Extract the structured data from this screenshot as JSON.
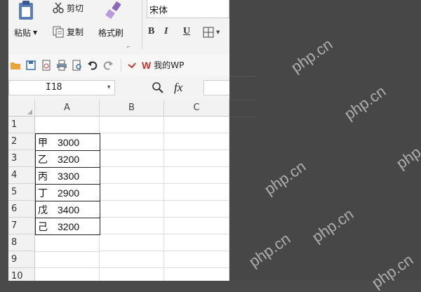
{
  "ribbon": {
    "paste_label": "粘贴",
    "cut_label": "剪切",
    "copy_label": "复制",
    "format_painter_label": "格式刷",
    "font_name": "宋体",
    "bold": "B",
    "italic": "I",
    "underline": "U"
  },
  "quick_access": {
    "wps_label": "我的WP"
  },
  "formula_bar": {
    "name_box": "I18",
    "fx": "fx"
  },
  "grid": {
    "columns": [
      "A",
      "B",
      "C"
    ],
    "rows": [
      "1",
      "2",
      "3",
      "4",
      "5",
      "6",
      "7",
      "8",
      "9",
      "10"
    ],
    "data": [
      {
        "name": "甲",
        "value": "3000"
      },
      {
        "name": "乙",
        "value": "3200"
      },
      {
        "name": "丙",
        "value": "3300"
      },
      {
        "name": "丁",
        "value": "2900"
      },
      {
        "name": "戊",
        "value": "3400"
      },
      {
        "name": "己",
        "value": "3200"
      }
    ]
  },
  "watermark": {
    "text": "php.cn"
  },
  "colors": {
    "wps_red": "#c6342c",
    "watermark": "#ffffff",
    "background": "#4a4a4a"
  }
}
